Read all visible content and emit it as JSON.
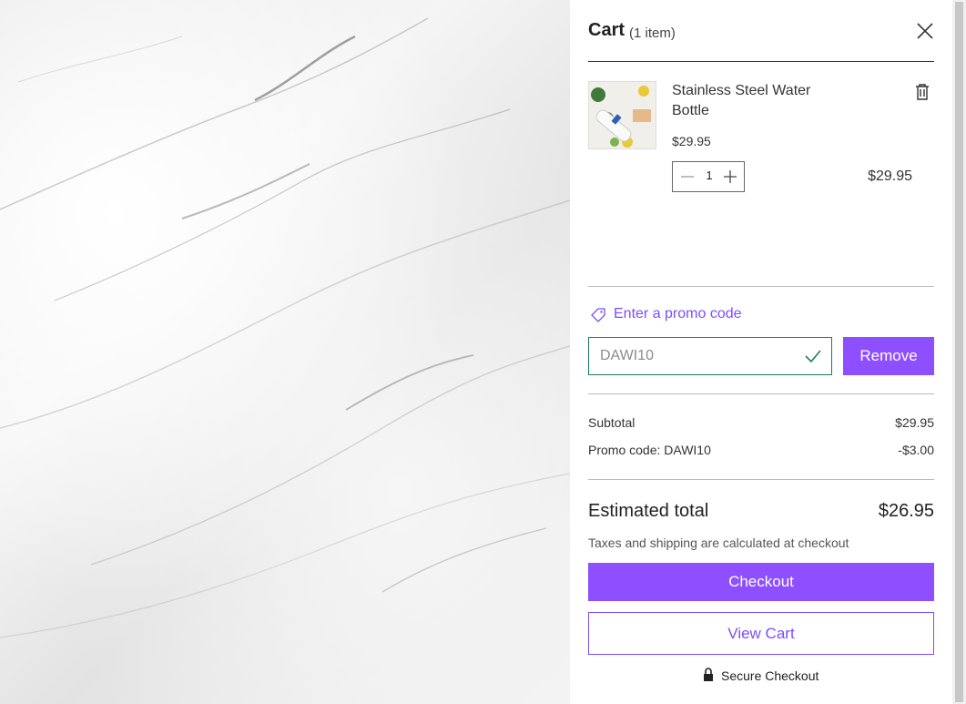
{
  "cart": {
    "title": "Cart",
    "count": "(1 item)"
  },
  "item": {
    "name": "Stainless Steel Water Bottle",
    "price": "$29.95",
    "quantity": "1",
    "line_total": "$29.95",
    "image_icon": "water-bottle-thumbnail"
  },
  "promo": {
    "link_label": "Enter a promo code",
    "code_value": "DAWI10",
    "remove_label": "Remove"
  },
  "summary": {
    "subtotal_label": "Subtotal",
    "subtotal_value": "$29.95",
    "promo_label": "Promo code: DAWI10",
    "promo_value": "-$3.00",
    "estimated_label": "Estimated total",
    "estimated_value": "$26.95",
    "tax_note": "Taxes and shipping are calculated at checkout"
  },
  "actions": {
    "checkout_label": "Checkout",
    "view_cart_label": "View Cart",
    "secure_label": "Secure Checkout"
  },
  "colors": {
    "accent": "#8d4fff",
    "valid_border": "#1f7a5c"
  }
}
